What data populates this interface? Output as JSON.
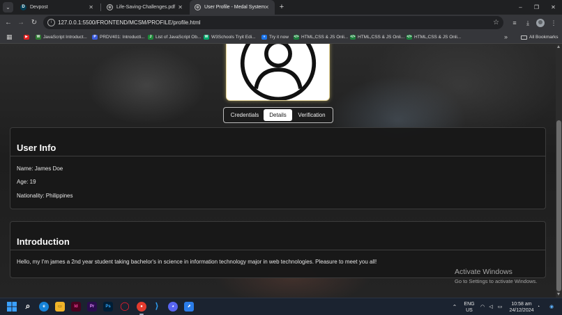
{
  "browser": {
    "tabs": [
      {
        "title": "Devpost",
        "favicon": "D",
        "active": false
      },
      {
        "title": "Life-Saving-Challenges.pdf",
        "favicon": "⊕",
        "active": false
      },
      {
        "title": "User Profile - Medal System",
        "favicon": "⊕",
        "active": true
      }
    ],
    "new_tab_glyph": "+",
    "window_controls": {
      "minimize": "–",
      "restore": "❐",
      "close": "✕"
    },
    "url": "127.0.0.1:5500/FRONTEND/MCSM/PROFILE/profile.html",
    "bookmarks": [
      "JavaScript Introduct...",
      "PRDV401: Introducti...",
      "List of JavaScript Ob...",
      "W3Schools Tryit Edi...",
      "Try it now",
      "HTML,CSS & JS Onli...",
      "HTML,CSS & JS Onli...",
      "HTML,CSS & JS Onli..."
    ],
    "bookmarks_more": "»",
    "all_bookmarks": "All Bookmarks"
  },
  "profile": {
    "tabs": [
      {
        "label": "Credentials",
        "active": false
      },
      {
        "label": "Details",
        "active": true
      },
      {
        "label": "Verification",
        "active": false
      }
    ],
    "user_info": {
      "title": "User Info",
      "name": "Name: James Doe",
      "age": "Age: 19",
      "nationality": "Nationality: Philippines"
    },
    "introduction": {
      "title": "Introduction",
      "text": "Hello, my I'm james a 2nd year student taking bachelor's in science in information technology major in web technologies. Pleasure to meet you all!"
    }
  },
  "watermark": {
    "line1": "Activate Windows",
    "line2": "Go to Settings to activate Windows."
  },
  "taskbar": {
    "language": "ENG",
    "region": "US",
    "time": "10:58 am",
    "date": "24/12/2024"
  },
  "colors": {
    "accent_active_tab": "#ffffff",
    "avatar_glow": "#e9d89a",
    "card_background": "#181818",
    "taskbar": "#1b2330"
  }
}
